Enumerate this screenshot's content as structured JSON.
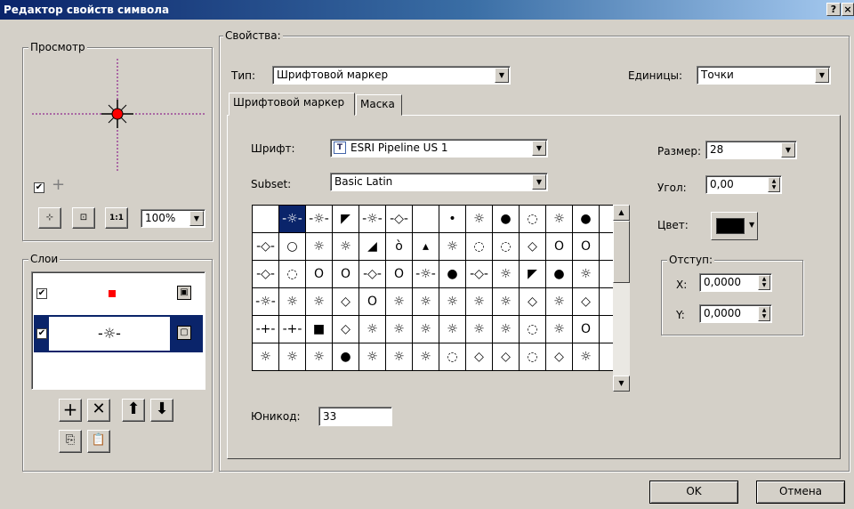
{
  "window": {
    "title": "Редактор свойств символа",
    "help_btn": "?",
    "close_btn": "×"
  },
  "preview": {
    "legend": "Просмотр",
    "zoom": "100%"
  },
  "layers": {
    "legend": "Слои"
  },
  "props": {
    "legend": "Свойства:",
    "type_label": "Тип:",
    "type_value": "Шрифтовой маркер",
    "units_label": "Единицы:",
    "units_value": "Точки"
  },
  "tabs": [
    "Шрифтовой маркер",
    "Маска"
  ],
  "font": {
    "label": "Шрифт:",
    "value": "ESRI Pipeline US 1",
    "subset_label": "Subset:",
    "subset_value": "Basic Latin",
    "unicode_label": "Юникод:",
    "unicode_value": "33"
  },
  "right": {
    "size_label": "Размер:",
    "size_value": "28",
    "angle_label": "Угол:",
    "angle_value": "0,00",
    "color_label": "Цвет:",
    "color_value": "#000000",
    "offset_legend": "Отступ:",
    "x_label": "X:",
    "x_value": "0,0000",
    "y_label": "Y:",
    "y_value": "0,0000"
  },
  "buttons": {
    "ok": "OK",
    "cancel": "Отмена"
  },
  "glyphs": [
    "",
    "-☼-",
    "-☼-",
    "◤",
    "-☼-",
    "-◇-",
    "",
    "•",
    "☼",
    "●",
    "◌",
    "☼",
    "●",
    "",
    "-◇-",
    "○",
    "☼",
    "☼",
    "◢",
    "ò",
    "▴",
    "☼",
    "◌",
    "◌",
    "◇",
    "O",
    "O",
    "",
    "-◇-",
    "◌",
    "O",
    "O",
    "-◇-",
    "O",
    "-☼-",
    "●",
    "-◇-",
    "☼",
    "◤",
    "●",
    "☼",
    "",
    "-☼-",
    "☼",
    "☼",
    "◇",
    "O",
    "☼",
    "☼",
    "☼",
    "☼",
    "☼",
    "◇",
    "☼",
    "◇",
    "",
    "-+-",
    "-+-",
    "■",
    "◇",
    "☼",
    "☼",
    "☼",
    "☼",
    "☼",
    "☼",
    "◌",
    "☼",
    "O",
    "",
    "☼",
    "☼",
    "☼",
    "●",
    "☼",
    "☼",
    "☼",
    "◌",
    "◇",
    "◇",
    "◌",
    "◇",
    "☼",
    ""
  ]
}
